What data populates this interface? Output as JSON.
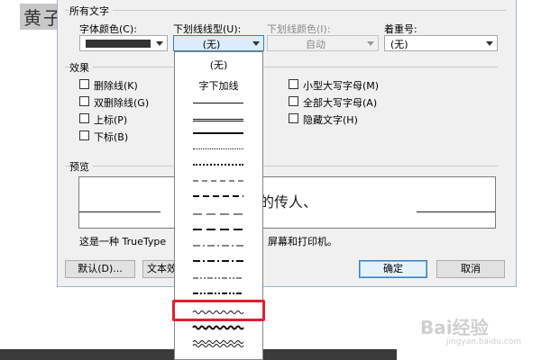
{
  "document": {
    "text": "黄子"
  },
  "dialog": {
    "section_all_text": "所有文字",
    "font_color": {
      "label": "字体颜色(C):"
    },
    "underline_style": {
      "label": "下划线线型(U):",
      "value": "(无)"
    },
    "underline_color": {
      "label": "下划线颜色(I):",
      "value": "自动"
    },
    "emphasis": {
      "label": "着重号:",
      "value": "(无)"
    },
    "effects": {
      "title": "效果",
      "items": [
        {
          "label": "删除线(K)"
        },
        {
          "label": "双删除线(G)"
        },
        {
          "label": "上标(P)"
        },
        {
          "label": "下标(B)"
        },
        {
          "label": "小型大写字母(M)"
        },
        {
          "label": "全部大写字母(A)"
        },
        {
          "label": "隐藏文字(H)"
        }
      ]
    },
    "preview": {
      "title": "预览",
      "sample_text": "的传人、",
      "caption_left": "这是一种 TrueType",
      "caption_right": "屏幕和打印机。"
    },
    "buttons": {
      "default": "默认(D)...",
      "text_effects": "文本效",
      "ok": "确定",
      "cancel": "取消"
    }
  },
  "dropdown": {
    "items": [
      {
        "label": "(无)"
      },
      {
        "label": "字下加线"
      }
    ]
  },
  "watermark": {
    "brand": "Bai经验",
    "sub": "jingyan.baidu.com"
  },
  "colors": {
    "highlight": "#e02030",
    "font_color_swatch": "#333333"
  }
}
